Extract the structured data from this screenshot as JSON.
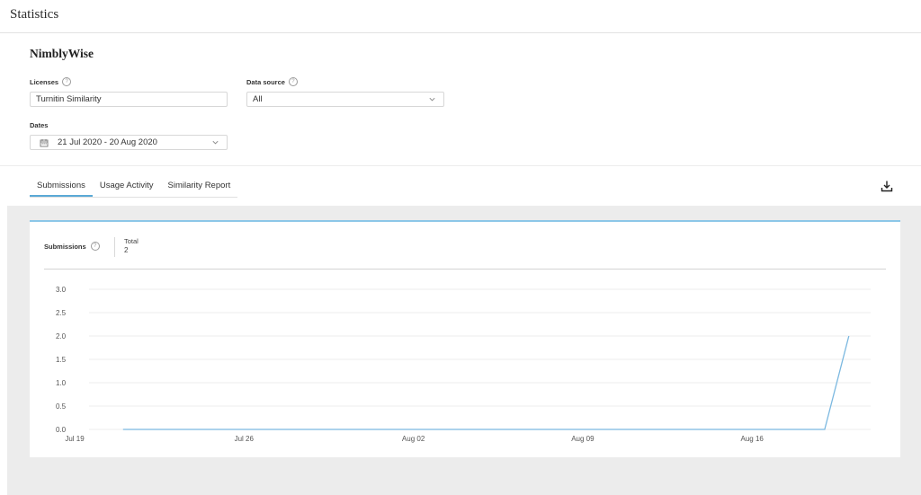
{
  "page": {
    "title": "Statistics"
  },
  "org": {
    "name": "NimblyWise"
  },
  "filters": {
    "licenses": {
      "label": "Licenses",
      "value": "Turnitin Similarity"
    },
    "data_source": {
      "label": "Data source",
      "value": "All"
    },
    "dates": {
      "label": "Dates",
      "value": "21 Jul 2020 - 20 Aug 2020"
    }
  },
  "help_glyph": "?",
  "tabs": [
    {
      "label": "Submissions",
      "active": true
    },
    {
      "label": "Usage Activity",
      "active": false
    },
    {
      "label": "Similarity Report",
      "active": false
    }
  ],
  "metric": {
    "label": "Submissions",
    "total_label": "Total",
    "total_value": "2"
  },
  "icons": {
    "help": "help-circle-icon",
    "calendar": "calendar-icon",
    "chevron": "chevron-down-icon",
    "download": "download-icon"
  },
  "colors": {
    "accent": "#5aa9d6",
    "series": "#7bb8e0",
    "background_panel": "#ececec"
  },
  "chart_data": {
    "type": "line",
    "y_ticks": [
      "0.0",
      "0.5",
      "1.0",
      "1.5",
      "2.0",
      "2.5",
      "3.0"
    ],
    "ylim": [
      0,
      3
    ],
    "x_ticks": [
      "Jul 19",
      "Jul 26",
      "Aug 02",
      "Aug 09",
      "Aug 16"
    ],
    "x_tick_dates": [
      "2020-07-19",
      "2020-07-26",
      "2020-08-02",
      "2020-08-09",
      "2020-08-16"
    ],
    "grid": "horizontal",
    "series": [
      {
        "x": [
          "2020-07-21",
          "2020-07-22",
          "2020-07-23",
          "2020-07-24",
          "2020-07-25",
          "2020-07-26",
          "2020-07-27",
          "2020-07-28",
          "2020-07-29",
          "2020-07-30",
          "2020-07-31",
          "2020-08-01",
          "2020-08-02",
          "2020-08-03",
          "2020-08-04",
          "2020-08-05",
          "2020-08-06",
          "2020-08-07",
          "2020-08-08",
          "2020-08-09",
          "2020-08-10",
          "2020-08-11",
          "2020-08-12",
          "2020-08-13",
          "2020-08-14",
          "2020-08-15",
          "2020-08-16",
          "2020-08-17",
          "2020-08-18",
          "2020-08-19",
          "2020-08-20"
        ],
        "values": [
          0,
          0,
          0,
          0,
          0,
          0,
          0,
          0,
          0,
          0,
          0,
          0,
          0,
          0,
          0,
          0,
          0,
          0,
          0,
          0,
          0,
          0,
          0,
          0,
          0,
          0,
          0,
          0,
          0,
          0,
          2
        ]
      }
    ]
  }
}
